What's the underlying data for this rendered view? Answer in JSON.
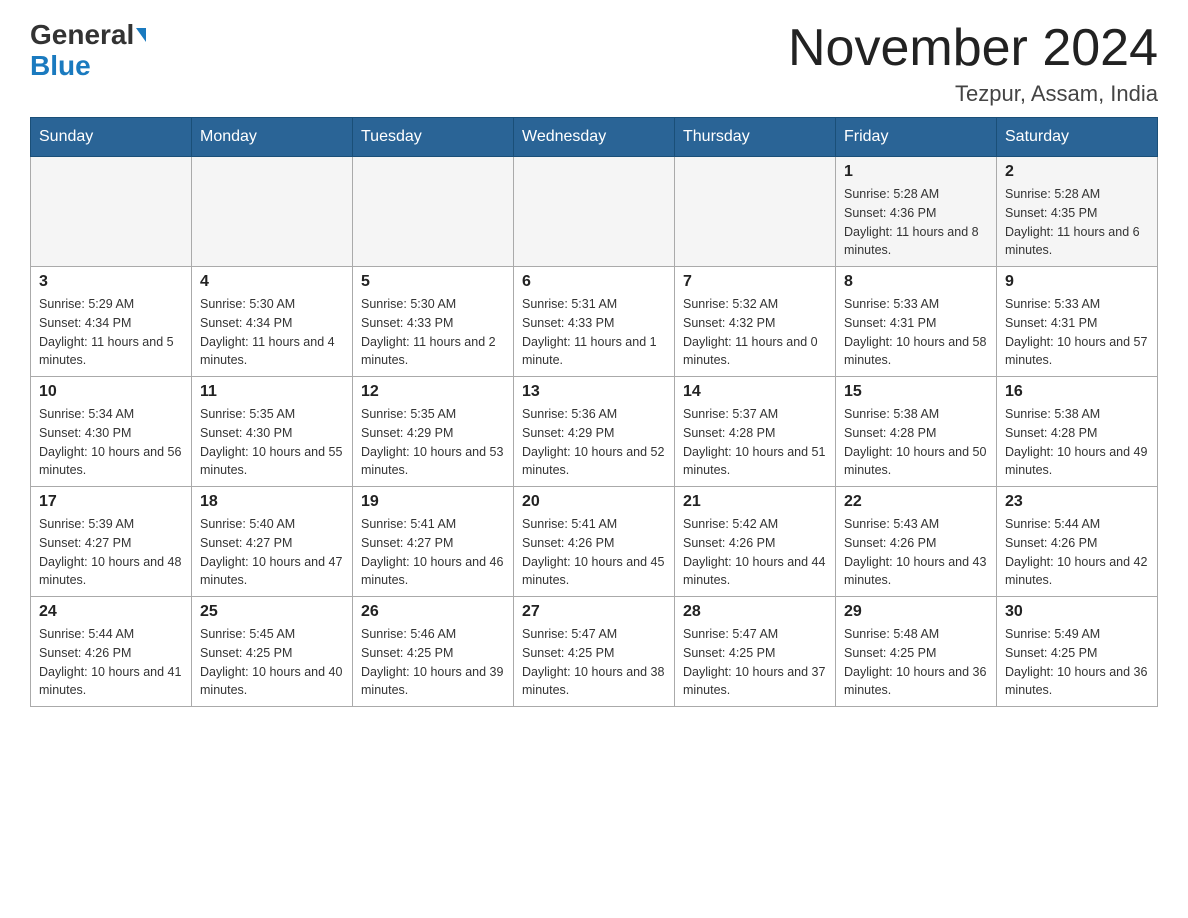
{
  "header": {
    "logo_general": "General",
    "logo_blue": "Blue",
    "month_title": "November 2024",
    "location": "Tezpur, Assam, India"
  },
  "weekdays": [
    "Sunday",
    "Monday",
    "Tuesday",
    "Wednesday",
    "Thursday",
    "Friday",
    "Saturday"
  ],
  "weeks": [
    [
      {
        "day": "",
        "info": ""
      },
      {
        "day": "",
        "info": ""
      },
      {
        "day": "",
        "info": ""
      },
      {
        "day": "",
        "info": ""
      },
      {
        "day": "",
        "info": ""
      },
      {
        "day": "1",
        "info": "Sunrise: 5:28 AM\nSunset: 4:36 PM\nDaylight: 11 hours and 8 minutes."
      },
      {
        "day": "2",
        "info": "Sunrise: 5:28 AM\nSunset: 4:35 PM\nDaylight: 11 hours and 6 minutes."
      }
    ],
    [
      {
        "day": "3",
        "info": "Sunrise: 5:29 AM\nSunset: 4:34 PM\nDaylight: 11 hours and 5 minutes."
      },
      {
        "day": "4",
        "info": "Sunrise: 5:30 AM\nSunset: 4:34 PM\nDaylight: 11 hours and 4 minutes."
      },
      {
        "day": "5",
        "info": "Sunrise: 5:30 AM\nSunset: 4:33 PM\nDaylight: 11 hours and 2 minutes."
      },
      {
        "day": "6",
        "info": "Sunrise: 5:31 AM\nSunset: 4:33 PM\nDaylight: 11 hours and 1 minute."
      },
      {
        "day": "7",
        "info": "Sunrise: 5:32 AM\nSunset: 4:32 PM\nDaylight: 11 hours and 0 minutes."
      },
      {
        "day": "8",
        "info": "Sunrise: 5:33 AM\nSunset: 4:31 PM\nDaylight: 10 hours and 58 minutes."
      },
      {
        "day": "9",
        "info": "Sunrise: 5:33 AM\nSunset: 4:31 PM\nDaylight: 10 hours and 57 minutes."
      }
    ],
    [
      {
        "day": "10",
        "info": "Sunrise: 5:34 AM\nSunset: 4:30 PM\nDaylight: 10 hours and 56 minutes."
      },
      {
        "day": "11",
        "info": "Sunrise: 5:35 AM\nSunset: 4:30 PM\nDaylight: 10 hours and 55 minutes."
      },
      {
        "day": "12",
        "info": "Sunrise: 5:35 AM\nSunset: 4:29 PM\nDaylight: 10 hours and 53 minutes."
      },
      {
        "day": "13",
        "info": "Sunrise: 5:36 AM\nSunset: 4:29 PM\nDaylight: 10 hours and 52 minutes."
      },
      {
        "day": "14",
        "info": "Sunrise: 5:37 AM\nSunset: 4:28 PM\nDaylight: 10 hours and 51 minutes."
      },
      {
        "day": "15",
        "info": "Sunrise: 5:38 AM\nSunset: 4:28 PM\nDaylight: 10 hours and 50 minutes."
      },
      {
        "day": "16",
        "info": "Sunrise: 5:38 AM\nSunset: 4:28 PM\nDaylight: 10 hours and 49 minutes."
      }
    ],
    [
      {
        "day": "17",
        "info": "Sunrise: 5:39 AM\nSunset: 4:27 PM\nDaylight: 10 hours and 48 minutes."
      },
      {
        "day": "18",
        "info": "Sunrise: 5:40 AM\nSunset: 4:27 PM\nDaylight: 10 hours and 47 minutes."
      },
      {
        "day": "19",
        "info": "Sunrise: 5:41 AM\nSunset: 4:27 PM\nDaylight: 10 hours and 46 minutes."
      },
      {
        "day": "20",
        "info": "Sunrise: 5:41 AM\nSunset: 4:26 PM\nDaylight: 10 hours and 45 minutes."
      },
      {
        "day": "21",
        "info": "Sunrise: 5:42 AM\nSunset: 4:26 PM\nDaylight: 10 hours and 44 minutes."
      },
      {
        "day": "22",
        "info": "Sunrise: 5:43 AM\nSunset: 4:26 PM\nDaylight: 10 hours and 43 minutes."
      },
      {
        "day": "23",
        "info": "Sunrise: 5:44 AM\nSunset: 4:26 PM\nDaylight: 10 hours and 42 minutes."
      }
    ],
    [
      {
        "day": "24",
        "info": "Sunrise: 5:44 AM\nSunset: 4:26 PM\nDaylight: 10 hours and 41 minutes."
      },
      {
        "day": "25",
        "info": "Sunrise: 5:45 AM\nSunset: 4:25 PM\nDaylight: 10 hours and 40 minutes."
      },
      {
        "day": "26",
        "info": "Sunrise: 5:46 AM\nSunset: 4:25 PM\nDaylight: 10 hours and 39 minutes."
      },
      {
        "day": "27",
        "info": "Sunrise: 5:47 AM\nSunset: 4:25 PM\nDaylight: 10 hours and 38 minutes."
      },
      {
        "day": "28",
        "info": "Sunrise: 5:47 AM\nSunset: 4:25 PM\nDaylight: 10 hours and 37 minutes."
      },
      {
        "day": "29",
        "info": "Sunrise: 5:48 AM\nSunset: 4:25 PM\nDaylight: 10 hours and 36 minutes."
      },
      {
        "day": "30",
        "info": "Sunrise: 5:49 AM\nSunset: 4:25 PM\nDaylight: 10 hours and 36 minutes."
      }
    ]
  ]
}
